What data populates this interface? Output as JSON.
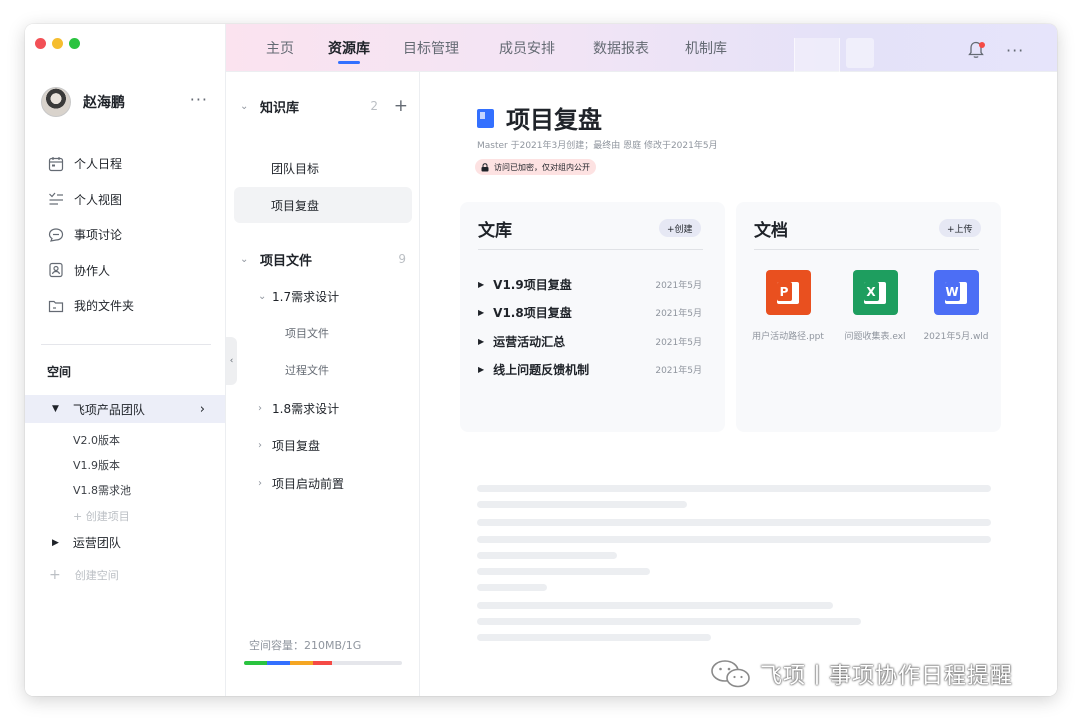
{
  "user": {
    "name": "赵海鹏",
    "more": "···"
  },
  "nav": [
    {
      "label": "个人日程",
      "icon": "calendar-icon"
    },
    {
      "label": "个人视图",
      "icon": "view-list-icon"
    },
    {
      "label": "事项讨论",
      "icon": "chat-bubble-icon"
    },
    {
      "label": "协作人",
      "icon": "contact-card-icon"
    },
    {
      "label": "我的文件夹",
      "icon": "folder-icon"
    }
  ],
  "space": {
    "title": "空间",
    "active_team": "飞项产品团队",
    "team_items": [
      "V2.0版本",
      "V1.9版本",
      "V1.8需求池"
    ],
    "create_project": "+ 创建项目",
    "other_team": "运营团队",
    "create_space": "创建空间"
  },
  "tabs": [
    {
      "label": "主页",
      "active": false
    },
    {
      "label": "资源库",
      "active": true
    },
    {
      "label": "目标管理",
      "active": false
    },
    {
      "label": "成员安排",
      "active": false
    },
    {
      "label": "数据报表",
      "active": false
    },
    {
      "label": "机制库",
      "active": false
    }
  ],
  "top_more": "···",
  "tree": {
    "kb": {
      "label": "知识库",
      "count": "2",
      "add": "+"
    },
    "kb_items": [
      {
        "label": "团队目标",
        "selected": false
      },
      {
        "label": "项目复盘",
        "selected": true
      }
    ],
    "files": {
      "label": "项目文件",
      "count": "9"
    },
    "file_items": [
      {
        "label": "1.7需求设计",
        "level": 1,
        "arrow": "⌄"
      },
      {
        "label": "项目文件",
        "level": 2,
        "arrow": ""
      },
      {
        "label": "过程文件",
        "level": 2,
        "arrow": ""
      },
      {
        "label": "1.8需求设计",
        "level": 1,
        "arrow": "›"
      },
      {
        "label": "项目复盘",
        "level": 1,
        "arrow": "›"
      },
      {
        "label": "项目启动前置",
        "level": 1,
        "arrow": "›"
      }
    ],
    "storage": "空间容量：210MB/1G",
    "storage_segments": [
      {
        "color": "#2ac33f",
        "fraction": 0.145
      },
      {
        "color": "#3370ff",
        "fraction": 0.145
      },
      {
        "color": "#f5a623",
        "fraction": 0.145
      },
      {
        "color": "#f54a45",
        "fraction": 0.12
      }
    ]
  },
  "doc": {
    "title": "项目复盘",
    "meta": "Master 于2021年3月创建；最终由 恩庭 修改于2021年5月",
    "lock": "访问已加密，仅对组内公开"
  },
  "library": {
    "title": "文库",
    "button": "+创建",
    "rows": [
      {
        "label": "V1.9项目复盘",
        "date": "2021年5月"
      },
      {
        "label": "V1.8项目复盘",
        "date": "2021年5月"
      },
      {
        "label": "运营活动汇总",
        "date": "2021年5月"
      },
      {
        "label": "线上问题反馈机制",
        "date": "2021年5月"
      }
    ]
  },
  "documents": {
    "title": "文档",
    "button": "+上传",
    "files": [
      {
        "name": "用户活动路径.ppt",
        "letter": "P",
        "color": "#e9501f",
        "icon": "powerpoint-file-icon"
      },
      {
        "name": "问题收集表.exl",
        "letter": "X",
        "color": "#1e9e5f",
        "icon": "excel-file-icon"
      },
      {
        "name": "2021年5月.wld",
        "letter": "W",
        "color": "#4c6ef5",
        "icon": "word-file-icon"
      }
    ]
  },
  "watermark": "飞项丨事项协作日程提醒"
}
